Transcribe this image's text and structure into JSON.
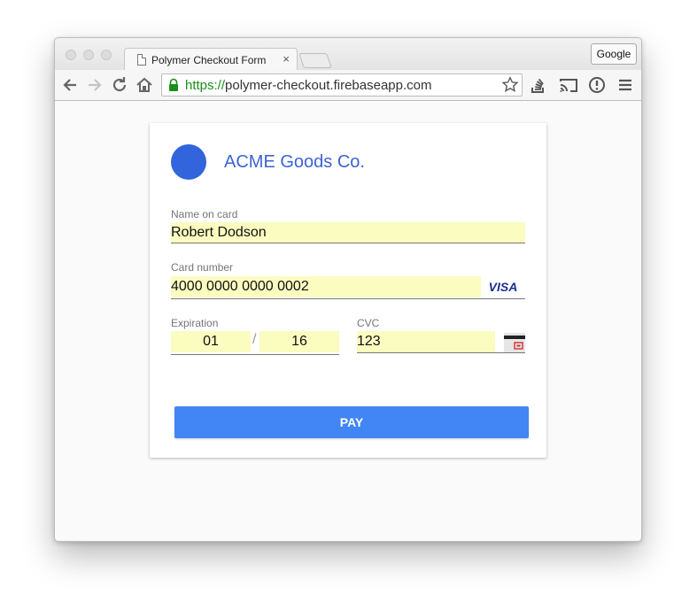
{
  "browser": {
    "tab_title": "Polymer Checkout Form",
    "tab_close": "×",
    "profile_button": "Google",
    "url_scheme": "https://",
    "url_rest": "polymer-checkout.firebaseapp.com"
  },
  "form": {
    "company_name": "ACME Goods Co.",
    "name_label": "Name on card",
    "name_value": "Robert Dodson",
    "card_label": "Card number",
    "card_value": "4000 0000 0000 0002",
    "card_brand": "VISA",
    "expiration_label": "Expiration",
    "exp_month": "01",
    "exp_separator": "/",
    "exp_year": "16",
    "cvc_label": "CVC",
    "cvc_value": "123",
    "pay_label": "PAY"
  },
  "colors": {
    "accent": "#4285f4",
    "logo": "#3264dc",
    "autofill": "#fafcc0",
    "secure": "#1b8f1b"
  }
}
